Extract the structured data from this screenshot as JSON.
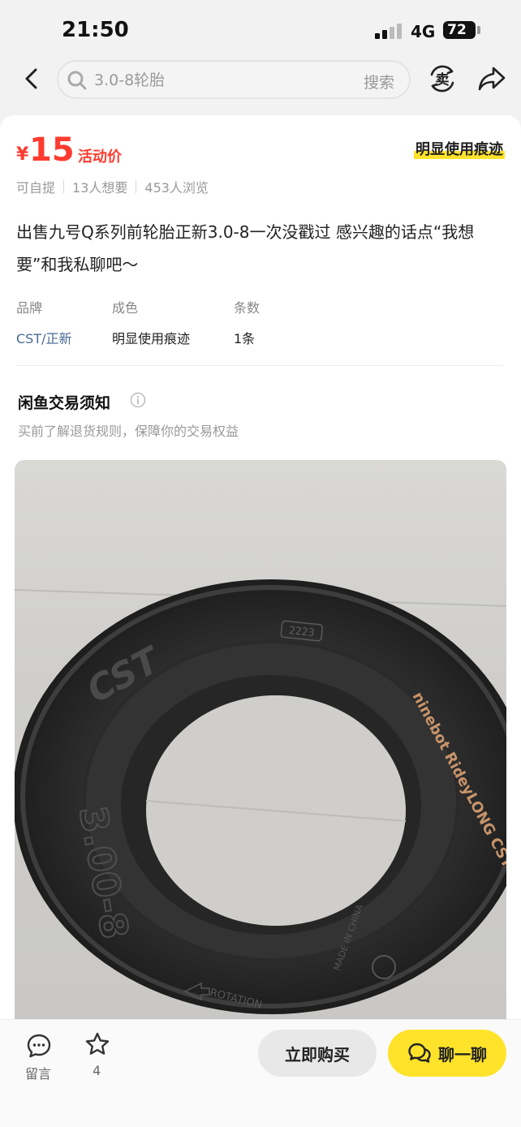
{
  "status_bar": {
    "time": "21:50",
    "network": "4G",
    "battery": "72"
  },
  "search": {
    "query": "3.0-8轮胎",
    "button": "搜索"
  },
  "header_icons": {
    "back": "chevron-left-icon",
    "sell": "sell-icon",
    "share": "share-icon",
    "sell_label": "卖"
  },
  "product": {
    "currency": "¥",
    "price": "15",
    "price_tag": "活动价",
    "condition_tag": "明显使用痕迹",
    "meta": [
      "可自提",
      "13人想要",
      "453人浏览"
    ],
    "description": "出售九号Q系列前轮胎正新3.0-8一次没戳过 感兴趣的话点“我想要”和我私聊吧～",
    "specs": [
      {
        "label": "品牌",
        "value": "CST/正新"
      },
      {
        "label": "成色",
        "value": "明显使用痕迹"
      },
      {
        "label": "条数",
        "value": "1条"
      }
    ]
  },
  "notice": {
    "title": "闲鱼交易须知",
    "subtitle": "买前了解退货规则，保障你的交易权益"
  },
  "photo": {
    "tire_brand": "CST",
    "date_code": "2223",
    "sidewall_text": "ninebot RideyLONG CST",
    "size": "3.00-8",
    "rotation": "ROTATION",
    "origin": "MADE IN CHINA"
  },
  "bottom_bar": {
    "comment_label": "留言",
    "favorite_count": "4",
    "buy_label": "立即购买",
    "chat_label": "聊一聊"
  },
  "colors": {
    "price": "#ff3b30",
    "accent_yellow": "#ffe32a",
    "link": "#4a6a95"
  }
}
